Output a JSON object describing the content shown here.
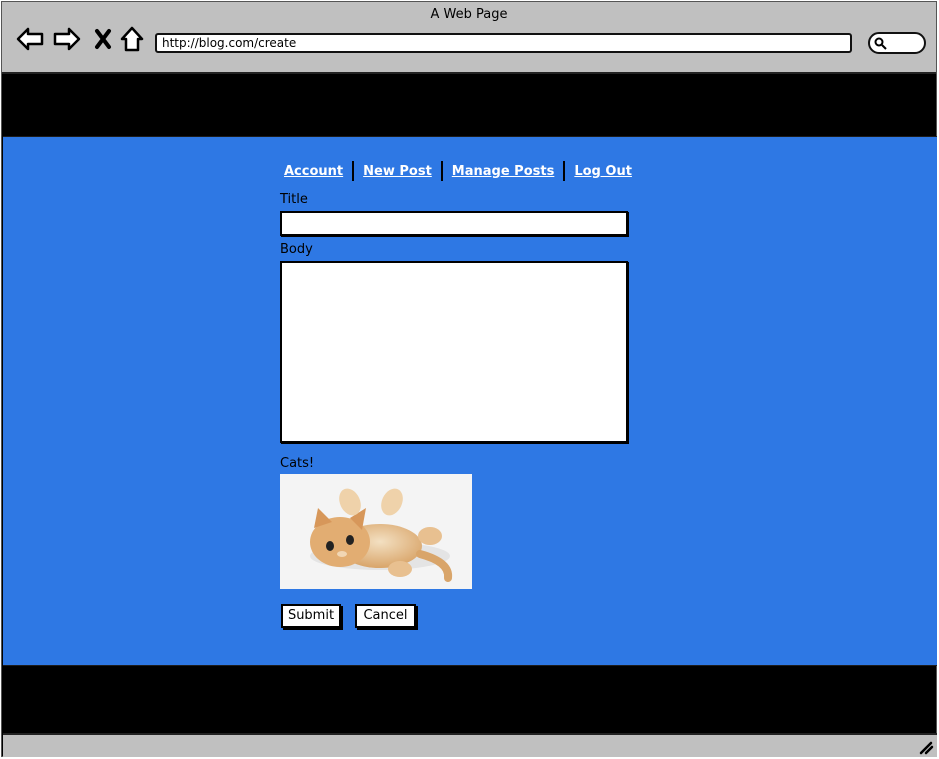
{
  "browser": {
    "window_title": "A Web Page",
    "url": "http://blog.com/create",
    "icons": [
      "back-arrow-icon",
      "forward-arrow-icon",
      "close-icon",
      "home-icon",
      "search-icon",
      "resize-grip-icon"
    ]
  },
  "nav": {
    "items": [
      {
        "label": "Account"
      },
      {
        "label": "New Post"
      },
      {
        "label": "Manage Posts"
      },
      {
        "label": "Log Out"
      }
    ]
  },
  "form": {
    "title_label": "Title",
    "title_value": "",
    "body_label": "Body",
    "body_value": "",
    "image_label": "Cats!",
    "submit_label": "Submit",
    "cancel_label": "Cancel"
  },
  "colors": {
    "page_background": "#2e78e4",
    "chrome": "#c0c0c0",
    "frame": "#000000"
  }
}
